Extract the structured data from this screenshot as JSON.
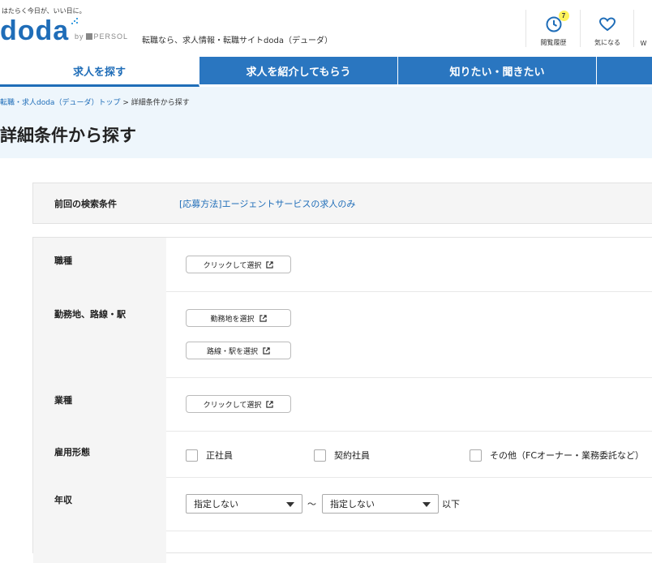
{
  "header": {
    "tagline": "はたらく今日が、いい日に。",
    "logo": "doda",
    "by": "by",
    "brand": "PERSOL",
    "site_desc": "転職なら、求人情報・転職サイトdoda（デューダ）",
    "history": {
      "label": "閲覧履歴",
      "badge": "7"
    },
    "favorites": {
      "label": "気になる"
    },
    "extra": "W"
  },
  "nav": {
    "tabs": [
      "求人を探す",
      "求人を紹介してもらう",
      "知りたい・聞きたい",
      ""
    ]
  },
  "breadcrumb": {
    "home": "転職・求人doda（デューダ）トップ",
    "sep": " > ",
    "current": "詳細条件から探す"
  },
  "page_title": "詳細条件から探す",
  "prev_search": {
    "label": "前回の検索条件",
    "value": "[応募方法]エージェントサービスの求人のみ"
  },
  "form": {
    "occupation": {
      "label": "職種",
      "button": "クリックして選択"
    },
    "location": {
      "label": "勤務地、路線・駅",
      "button1": "勤務地を選択",
      "button2": "路線・駅を選択"
    },
    "industry": {
      "label": "業種",
      "button": "クリックして選択"
    },
    "employment": {
      "label": "雇用形態",
      "options": [
        "正社員",
        "契約社員",
        "その他（FCオーナー・業務委託など）"
      ]
    },
    "salary": {
      "label": "年収",
      "min": "指定しない",
      "tilde": "〜",
      "max": "指定しない",
      "suffix": "以下"
    }
  },
  "colors": {
    "brand_blue": "#1f6db8",
    "nav_blue": "#2a76c0",
    "hero_bg": "#eef6fc",
    "badge": "#fff35c"
  }
}
